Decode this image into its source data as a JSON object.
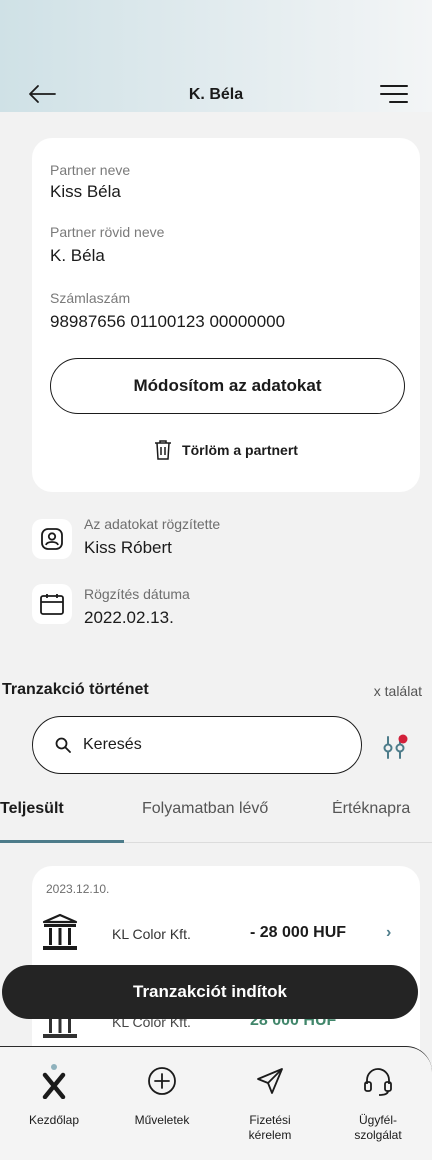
{
  "header": {
    "title": "K. Béla"
  },
  "partner": {
    "name_label": "Partner neve",
    "name_value": "Kiss Béla",
    "short_label": "Partner rövid neve",
    "short_value": "K. Béla",
    "account_label": "Számlaszám",
    "account_value": "98987656 01100123 00000000",
    "edit_button": "Módosítom az adatokat",
    "delete_link": "Törlöm a partnert"
  },
  "meta": {
    "recorded_by_label": "Az adatokat rögzítette",
    "recorded_by_value": "Kiss Róbert",
    "date_label": "Rögzítés dátuma",
    "date_value": "2022.02.13."
  },
  "transactions": {
    "title": "Tranzakció történet",
    "count": "x találat",
    "search_placeholder": "Keresés",
    "tabs": [
      {
        "label": "Teljesült"
      },
      {
        "label": "Folyamatban lévő"
      },
      {
        "label": "Értéknapra"
      }
    ],
    "date": "2023.12.10.",
    "items": [
      {
        "name": "KL Color Kft.",
        "amount": "- 28 000 HUF",
        "chevron": "›"
      },
      {
        "name": "KL Color Kft.",
        "amount": "28 000 HUF"
      }
    ],
    "cta": "Tranzakciót indítok"
  },
  "nav": {
    "items": [
      {
        "label": "Kezdőlap",
        "icon": "home-logo-icon"
      },
      {
        "label": "Műveletek",
        "icon": "plus-circle-icon"
      },
      {
        "label": "Fizetési kérelem",
        "icon": "send-icon"
      },
      {
        "label": "Ügyfél-szolgálat",
        "icon": "headset-icon"
      }
    ]
  },
  "colors": {
    "accent": "#4d7c8a",
    "dark": "#242424",
    "badge": "#d3203a"
  }
}
